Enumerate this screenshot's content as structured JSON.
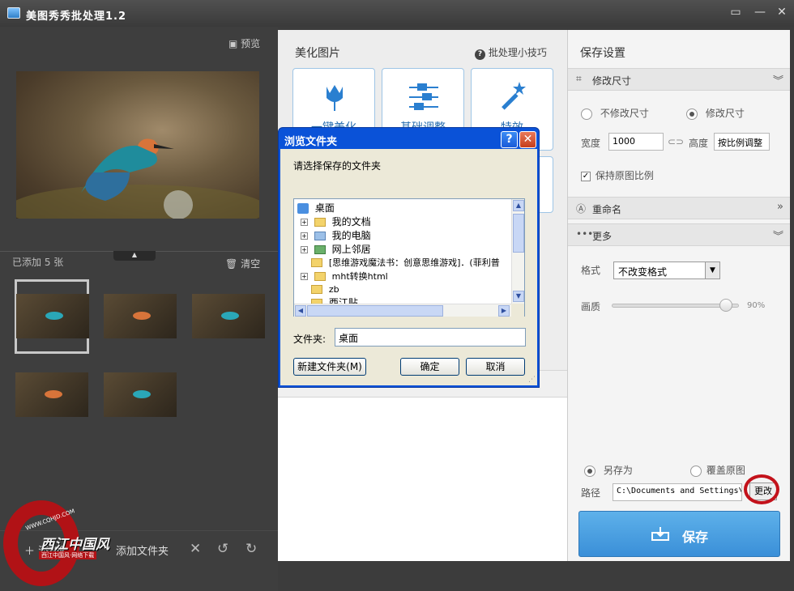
{
  "app": {
    "title": "美图秀秀批处理1.2"
  },
  "left": {
    "preview_label": "预览",
    "added_count": "已添加 5 张",
    "clear_label": "清空",
    "add_pic_label": "添加图片",
    "add_folder_label": "添加文件夹"
  },
  "middle": {
    "title": "美化图片",
    "tips_label": "批处理小技巧",
    "cards": [
      {
        "label": "一键美化",
        "icon": "tulip-icon"
      },
      {
        "label": "基础调整",
        "icon": "sliders-icon"
      },
      {
        "label": "特效",
        "icon": "magic-wand-icon"
      }
    ]
  },
  "right": {
    "title": "保存设置",
    "resize_section": "修改尺寸",
    "no_resize_label": "不修改尺寸",
    "resize_label": "修改尺寸",
    "width_label": "宽度",
    "width_value": "1000",
    "height_label": "高度",
    "height_value": "按比例调整",
    "keep_ratio_label": "保持原图比例",
    "rename_section": "重命名",
    "more_section": "更多",
    "format_label": "格式",
    "format_value": "不改变格式",
    "quality_label": "画质",
    "quality_value": "90%",
    "quality": 0.9,
    "save_as_label": "另存为",
    "overwrite_label": "覆盖原图",
    "path_label": "路径",
    "path_value": "C:\\Documents and Settings\\",
    "change_label": "更改",
    "save_label": "保存"
  },
  "dialog": {
    "title": "浏览文件夹",
    "prompt": "请选择保存的文件夹",
    "tree": [
      {
        "label": "桌面",
        "level": 0,
        "expand": false,
        "icon": "desktop-icon"
      },
      {
        "label": "我的文档",
        "level": 1,
        "expand": true,
        "icon": "documents-icon"
      },
      {
        "label": "我的电脑",
        "level": 1,
        "expand": true,
        "icon": "computer-icon"
      },
      {
        "label": "网上邻居",
        "level": 1,
        "expand": true,
        "icon": "network-icon"
      },
      {
        "label": "[思维游戏魔法书：创意思维游戏]．(菲利普",
        "level": 1,
        "expand": false,
        "icon": "folder-icon"
      },
      {
        "label": "mht转换html",
        "level": 1,
        "expand": true,
        "icon": "folder-icon"
      },
      {
        "label": "zb",
        "level": 1,
        "expand": false,
        "icon": "folder-icon"
      },
      {
        "label": "西江贴",
        "level": 1,
        "expand": false,
        "icon": "folder-icon"
      }
    ],
    "folder_label": "文件夹:",
    "folder_value": "桌面",
    "new_folder_label": "新建文件夹(M)",
    "ok_label": "确定",
    "cancel_label": "取消"
  },
  "watermark": {
    "url": "WWW.CQHJD.COM",
    "text": "西江中国风",
    "sub": "西江中国风·网络下载"
  },
  "colors": {
    "accent": "#3a8fd8",
    "dialog_title": "#0a52d8",
    "highlight_circle": "#c3121b"
  }
}
